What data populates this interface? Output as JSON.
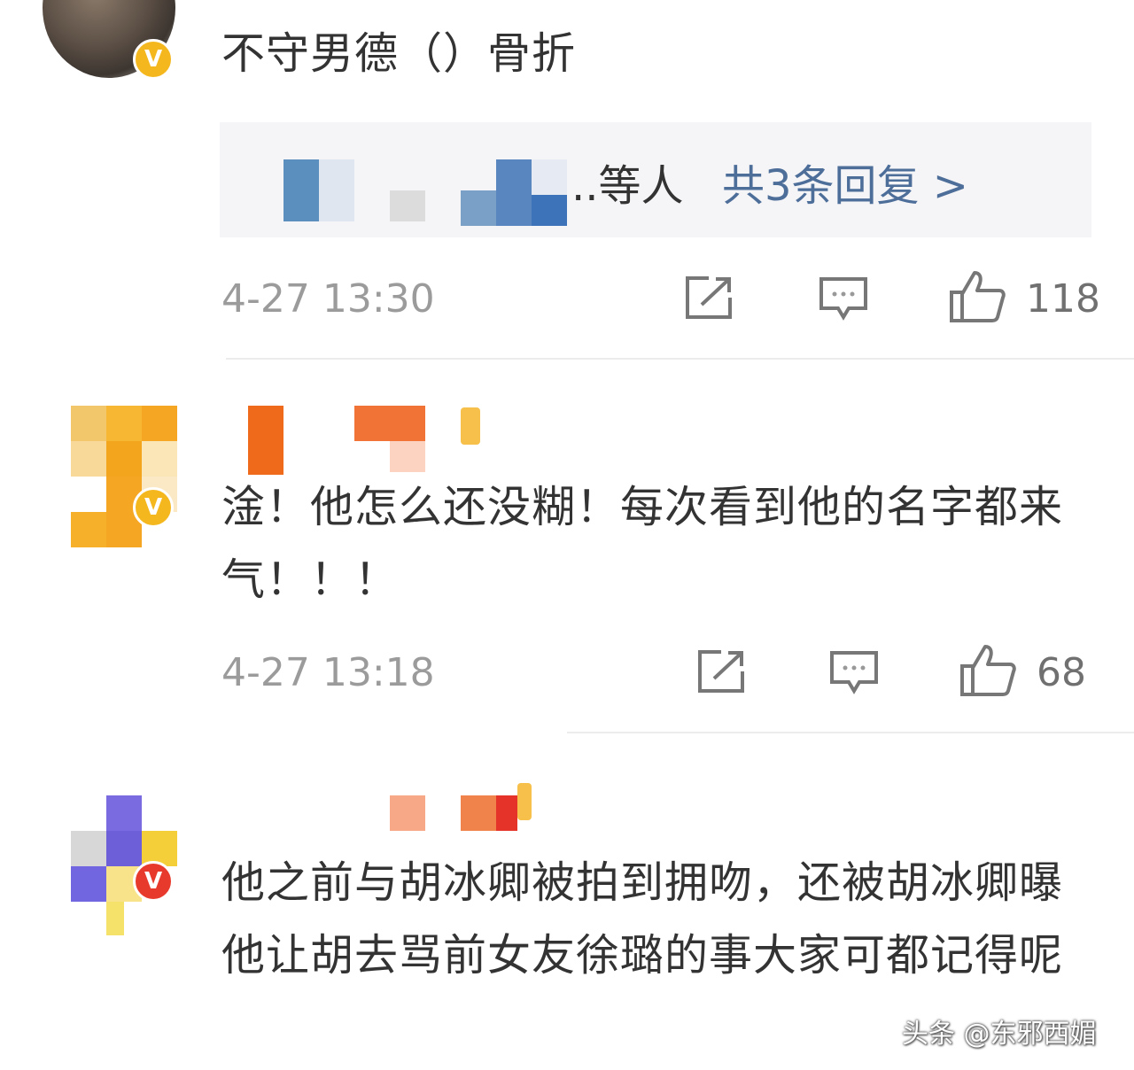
{
  "comments": [
    {
      "text": "不守男德（）骨折",
      "replies": {
        "users_suffix": "..等人",
        "count_label": "共3条回复 >"
      },
      "time": "4-27 13:30",
      "likes": "118",
      "badge": "V"
    },
    {
      "text": "淦！他怎么还没糊！每次看到他的名字都来气！！！",
      "time": "4-27 13:18",
      "likes": "68",
      "badge": "V"
    },
    {
      "text": "他之前与胡冰卿被拍到拥吻，还被胡冰卿曝他让胡去骂前女友徐璐的事大家可都记得呢",
      "badge": "V"
    }
  ],
  "icons": {
    "share": "share-icon",
    "comment": "comment-icon",
    "like": "thumbs-up-icon"
  },
  "watermark": "头条 @东邪西媚",
  "colors": {
    "link_blue": "#4e6e9a",
    "badge_gold": "#f4b71d",
    "badge_red": "#e83a2c",
    "timestamp_grey": "#9b9b9b"
  }
}
